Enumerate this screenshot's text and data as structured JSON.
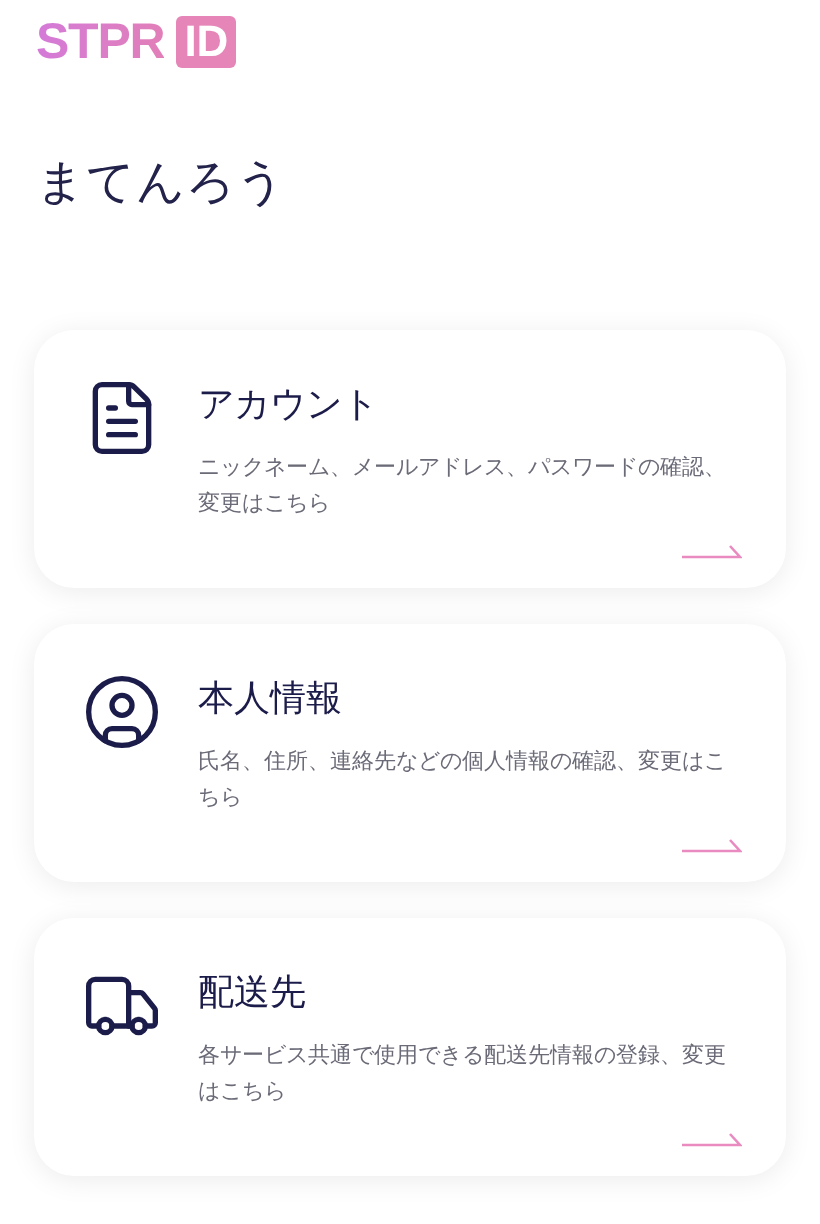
{
  "logo": {
    "name": "STPR",
    "badge": "ID"
  },
  "user_name": "まてんろう",
  "cards": [
    {
      "kind": "document",
      "title": "アカウント",
      "description": "ニックネーム、メールアドレス、パスワードの確認、変更はこちら"
    },
    {
      "kind": "person",
      "title": "本人情報",
      "description": "氏名、住所、連絡先などの個人情報の確認、変更はこちら"
    },
    {
      "kind": "truck",
      "title": "配送先",
      "description": "各サービス共通で使用できる配送先情報の登録、変更はこちら"
    }
  ]
}
